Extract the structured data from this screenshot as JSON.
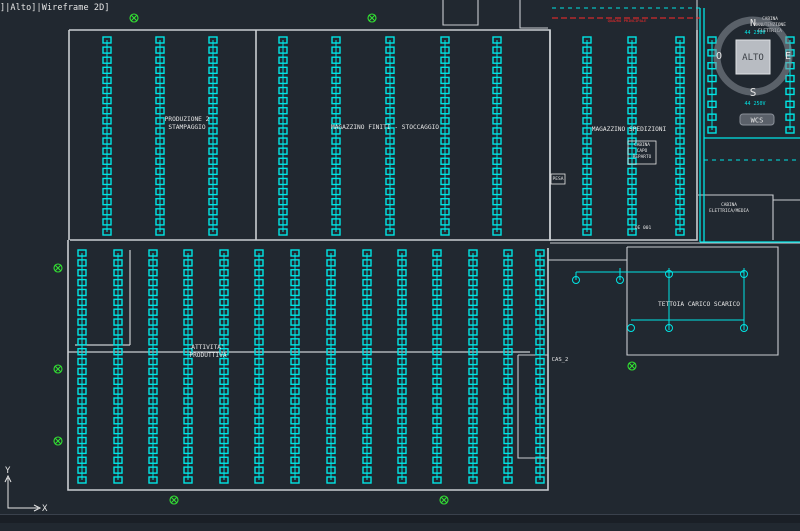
{
  "viewport": {
    "label": "]|Alto]|Wireframe 2D]"
  },
  "rooms": {
    "production2": [
      "PRODUZIONE 2",
      "STAMPAGGIO"
    ],
    "warehouse": "MAGAZZINO FINITI - STOCCAGGIO",
    "shipping": "MAGAZZINO SPEDIZIONI",
    "activity": [
      "ATTIVITA'",
      "PRODUTTIVA"
    ],
    "canopy": "TETTOIA CARICO SCARICO",
    "cabin": [
      "CABINA",
      "CAPO",
      "REPARTO"
    ],
    "electrical": [
      "CABINA",
      "ELETTRICA/MEDIA"
    ],
    "maintenance": [
      "CABINA",
      "MANUTENZIONE",
      "ELETTRICA"
    ],
    "pesa": "PESA",
    "qe": "QE 001",
    "cas": "CAS_2",
    "redlabel": "QUADRO PRINCIPALE"
  },
  "navcube": {
    "top_face": "ALTO",
    "north": "N",
    "south": "S",
    "west": "O",
    "east": "E",
    "coords": "WCS",
    "note_top": "44 250V",
    "note_bottom": "44 250V"
  },
  "ucs": {
    "x": "X",
    "y": "Y"
  },
  "colors": {
    "background": "#212830",
    "cyan": "#00e5e5",
    "wall": "#c9cdd1",
    "green": "#33e233",
    "red": "#ff2a2a",
    "label": "#e6e6e6"
  }
}
